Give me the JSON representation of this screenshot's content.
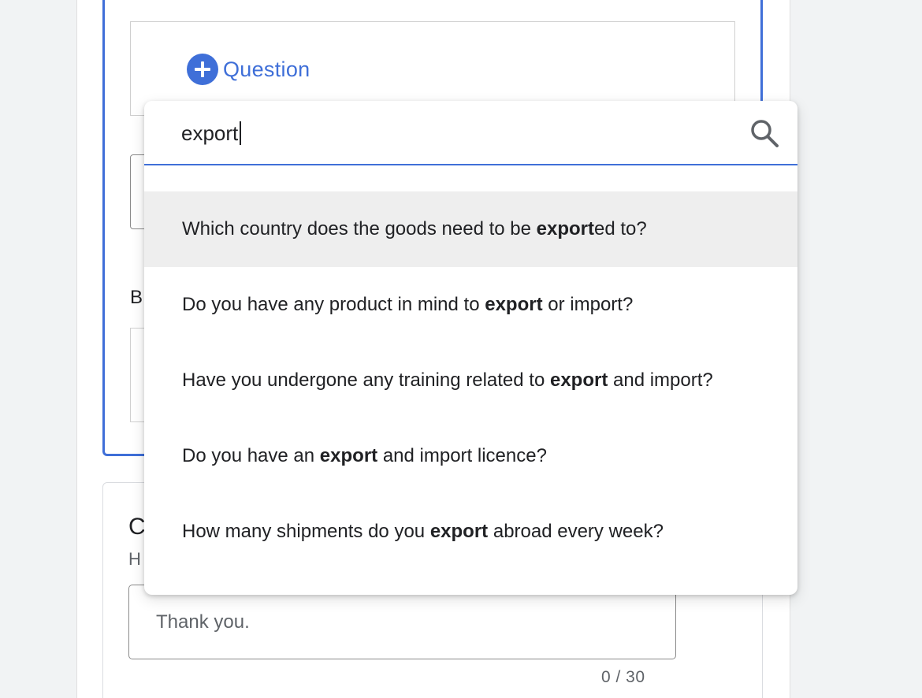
{
  "form": {
    "add_question_label": "Question",
    "section_label_partial": "B",
    "lower_card": {
      "title_partial": "C",
      "subtitle_partial": "H",
      "message_placeholder": "Thank you.",
      "counter": "0 / 30"
    }
  },
  "dropdown": {
    "search_value": "export",
    "results": [
      {
        "before": "Which country does the goods need to be ",
        "match": "export",
        "after": "ed to?",
        "highlighted": true
      },
      {
        "before": "Do you have any product in mind to ",
        "match": "export",
        "after": " or import?",
        "highlighted": false
      },
      {
        "before": "Have you undergone any training related to ",
        "match": "export",
        "after": " and import?",
        "highlighted": false
      },
      {
        "before": "Do you have an ",
        "match": "export",
        "after": " and import licence?",
        "highlighted": false
      },
      {
        "before": "How many shipments do you ",
        "match": "export",
        "after": " abroad every week?",
        "highlighted": false
      }
    ]
  },
  "colors": {
    "accent": "#3f6fd8",
    "highlight": "#eeeeee",
    "background": "#f1f3f4"
  },
  "icons": {
    "add": "plus-circle-icon",
    "search": "search-icon"
  }
}
